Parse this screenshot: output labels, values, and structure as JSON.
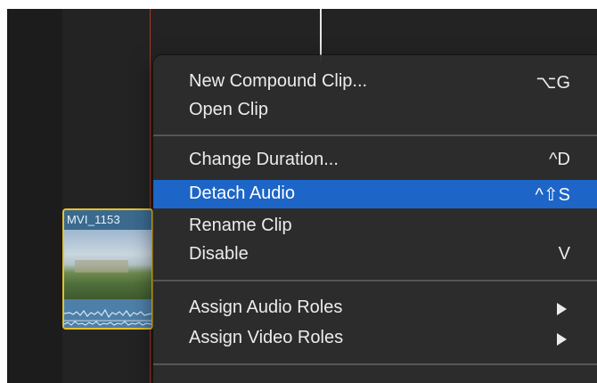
{
  "clip": {
    "name": "MVI_1153"
  },
  "menu": {
    "items": [
      {
        "label": "New Compound Clip...",
        "shortcut": "⌥G"
      },
      {
        "label": "Open Clip",
        "shortcut": ""
      },
      {
        "label": "Change Duration...",
        "shortcut": "^D"
      },
      {
        "label": "Detach Audio",
        "shortcut": "^⇧S",
        "highlighted": true
      },
      {
        "label": "Rename Clip",
        "shortcut": ""
      },
      {
        "label": "Disable",
        "shortcut": "V"
      },
      {
        "label": "Assign Audio Roles",
        "submenu": true
      },
      {
        "label": "Assign Video Roles",
        "submenu": true
      }
    ]
  },
  "colors": {
    "highlight": "#1d65c7",
    "clip_border": "#e7c12b",
    "playhead": "#c0392b",
    "menu_bg": "#2c2c2c"
  }
}
